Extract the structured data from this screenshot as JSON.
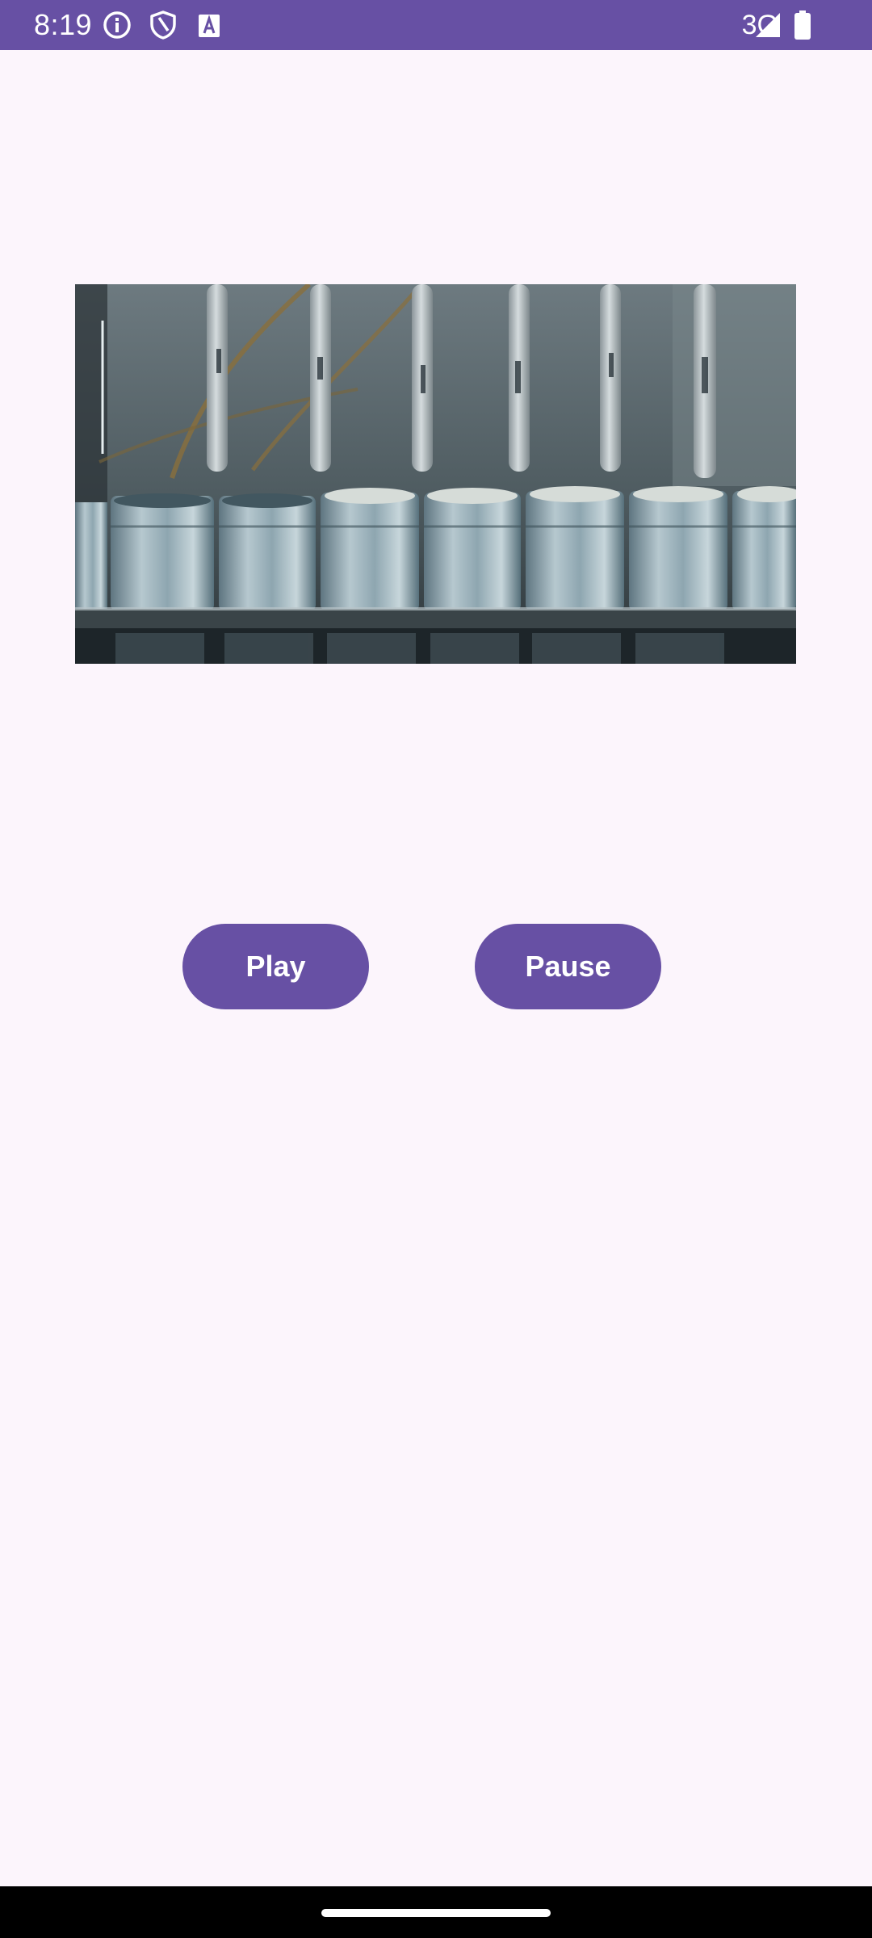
{
  "status_bar": {
    "time": "8:19",
    "network": "3G",
    "icons": [
      "info-icon",
      "shield-icon",
      "text-a-icon",
      "signal-icon",
      "battery-icon"
    ],
    "background_color": "#6750A4"
  },
  "video": {
    "description_icon": "video-preview"
  },
  "controls": {
    "play_label": "Play",
    "pause_label": "Pause",
    "accent_color": "#6750A4"
  },
  "app": {
    "background_color": "#FCF5FC"
  }
}
